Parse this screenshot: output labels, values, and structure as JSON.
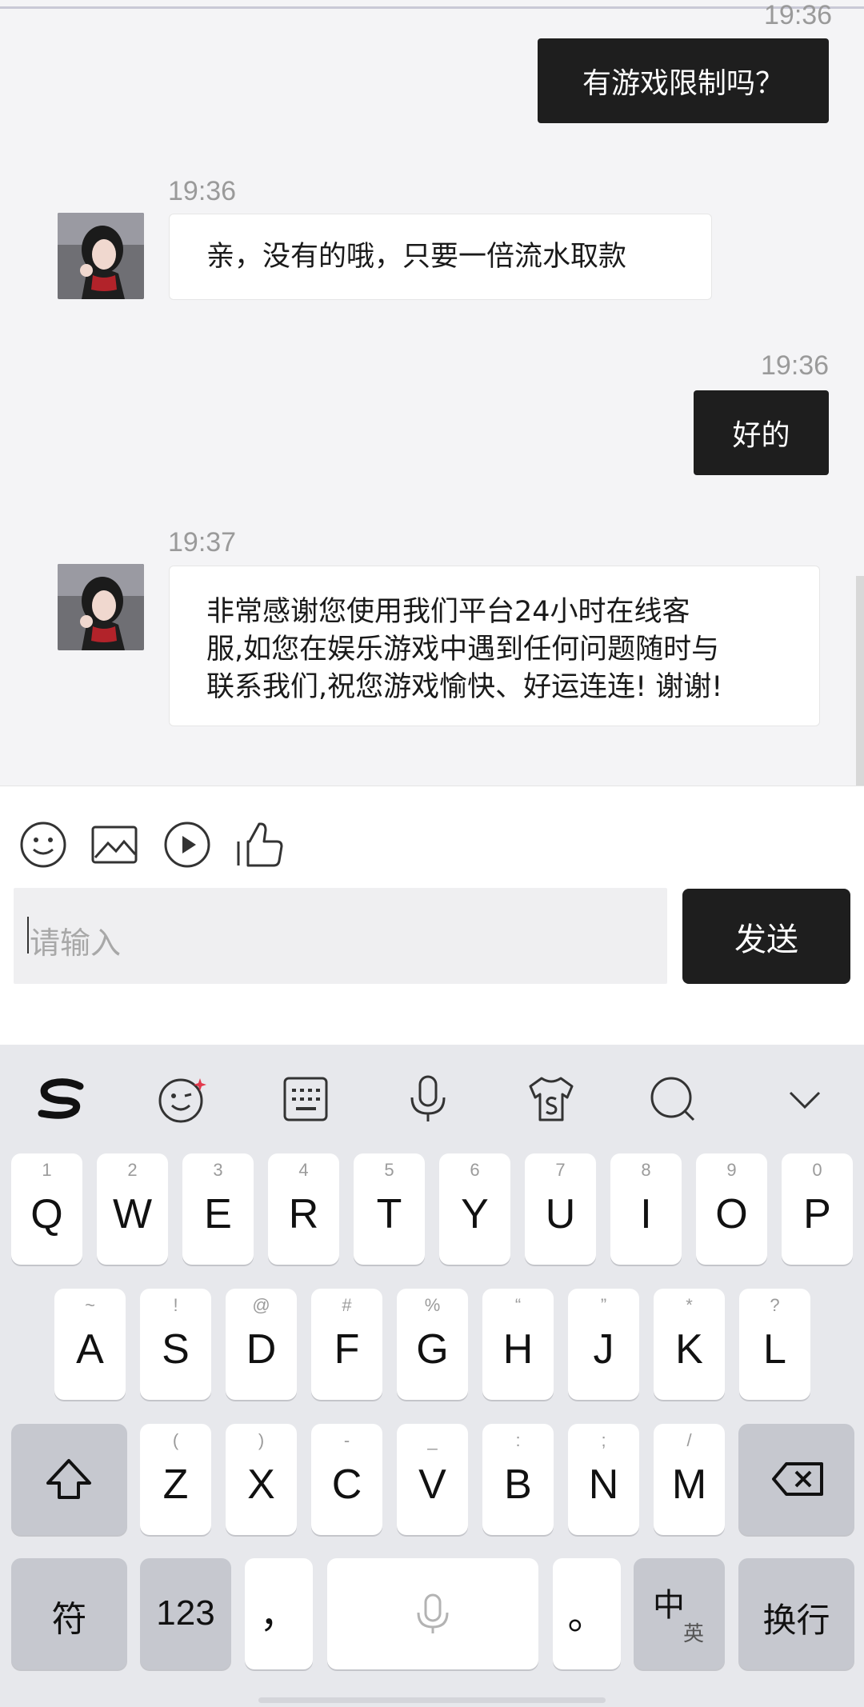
{
  "chat": {
    "messages": [
      {
        "side": "out",
        "time": "19:36",
        "text": "有游戏限制吗？"
      },
      {
        "side": "in",
        "time": "19:36",
        "text": "亲，没有的哦，只要一倍流水取款"
      },
      {
        "side": "out",
        "time": "19:36",
        "text": "好的"
      },
      {
        "side": "in",
        "time": "19:37",
        "lines": [
          "非常感谢您使用我们平台24小时在线客",
          "服,如您在娱乐游戏中遇到任何问题随时与",
          "联系我们,祝您游戏愉快、好运连连! 谢谢!"
        ]
      }
    ]
  },
  "composer": {
    "tools": [
      "emoji-icon",
      "image-icon",
      "video-play-icon",
      "thumbs-up-icon"
    ],
    "placeholder": "请输入",
    "send_label": "发送"
  },
  "keyboard": {
    "toolbar": [
      "sogou-logo-icon",
      "emoji-wink-icon",
      "keyboard-icon",
      "microphone-icon",
      "skin-shirt-icon",
      "search-icon",
      "collapse-chevron-icon"
    ],
    "row1": [
      {
        "label": "Q",
        "hint": "1"
      },
      {
        "label": "W",
        "hint": "2"
      },
      {
        "label": "E",
        "hint": "3"
      },
      {
        "label": "R",
        "hint": "4"
      },
      {
        "label": "T",
        "hint": "5"
      },
      {
        "label": "Y",
        "hint": "6"
      },
      {
        "label": "U",
        "hint": "7"
      },
      {
        "label": "I",
        "hint": "8"
      },
      {
        "label": "O",
        "hint": "9"
      },
      {
        "label": "P",
        "hint": "0"
      }
    ],
    "row2": [
      {
        "label": "A",
        "hint": "~"
      },
      {
        "label": "S",
        "hint": "!"
      },
      {
        "label": "D",
        "hint": "@"
      },
      {
        "label": "F",
        "hint": "#"
      },
      {
        "label": "G",
        "hint": "%"
      },
      {
        "label": "H",
        "hint": "“"
      },
      {
        "label": "J",
        "hint": "”"
      },
      {
        "label": "K",
        "hint": "*"
      },
      {
        "label": "L",
        "hint": "?"
      }
    ],
    "row3": [
      {
        "label": "Z",
        "hint": "("
      },
      {
        "label": "X",
        "hint": ")"
      },
      {
        "label": "C",
        "hint": "-"
      },
      {
        "label": "V",
        "hint": "_"
      },
      {
        "label": "B",
        "hint": ":"
      },
      {
        "label": "N",
        "hint": ";"
      },
      {
        "label": "M",
        "hint": "/"
      }
    ],
    "symbol_label": "符",
    "numbers_label": "123",
    "comma_label": "，",
    "period_label": "。",
    "lang_main": "中",
    "lang_sub": "英",
    "enter_label": "换行"
  }
}
